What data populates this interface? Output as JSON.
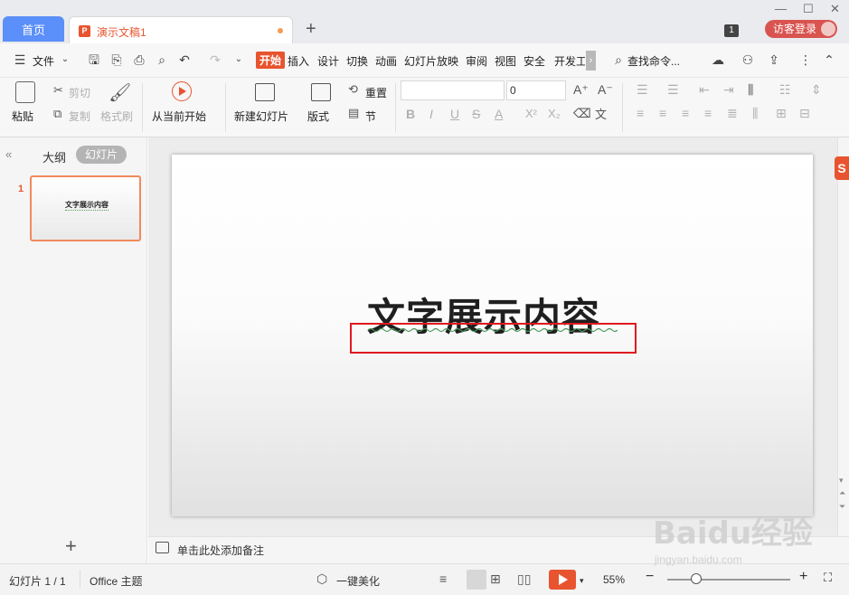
{
  "titlebar": {
    "home_tab": "首页",
    "doc_tab": "演示文稿1",
    "new_tab": "+",
    "badge": "1",
    "login": "访客登录",
    "minimize": "—",
    "maximize": "☐",
    "close": "✕"
  },
  "menu": {
    "file": "文件",
    "tabs": [
      "开始",
      "插入",
      "设计",
      "切换",
      "动画",
      "幻灯片放映",
      "审阅",
      "视图",
      "安全",
      "开发工"
    ],
    "search": "查找命令..."
  },
  "ribbon": {
    "paste": "粘贴",
    "cut": "剪切",
    "copy": "复制",
    "format_painter": "格式刷",
    "from_current": "从当前开始",
    "new_slide": "新建幻灯片",
    "layout": "版式",
    "reset": "重置",
    "section": "节",
    "font_size": "0"
  },
  "left_panel": {
    "outline_tab": "大纲",
    "slides_tab": "幻灯片",
    "slide_number": "1",
    "thumb_text": "文字展示内容"
  },
  "slide": {
    "title": "文字展示内容"
  },
  "notes": {
    "placeholder": "单击此处添加备注"
  },
  "status": {
    "slide_count": "幻灯片 1 / 1",
    "theme": "Office 主题",
    "beautify": "一键美化",
    "zoom": "55%",
    "zoom_level": 0.55
  },
  "watermark": {
    "logo": "Baidu经验",
    "url": "jingyan.baidu.com"
  },
  "colors": {
    "accent": "#e8542f",
    "home_tab": "#5b8ff9",
    "highlight_box": "#e0191f"
  }
}
